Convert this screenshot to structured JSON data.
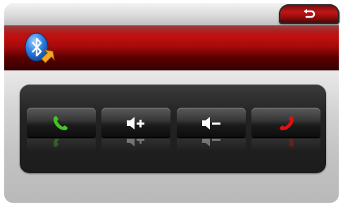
{
  "colors": {
    "accent_red": "#c21010",
    "call_green": "#3cc81e",
    "hangup_red": "#e01010",
    "button_dark": "#1a1a1a"
  },
  "icons": {
    "back": "return-arrow-icon",
    "bluetooth": "bluetooth-icon",
    "answer": "phone-answer-icon",
    "volume_up": "volume-up-icon",
    "volume_down": "volume-down-icon",
    "hangup": "phone-hangup-icon"
  },
  "controls": [
    {
      "id": "answer",
      "icon": "phone-answer-icon"
    },
    {
      "id": "volume_up",
      "icon": "volume-up-icon"
    },
    {
      "id": "volume_down",
      "icon": "volume-down-icon"
    },
    {
      "id": "hangup",
      "icon": "phone-hangup-icon"
    }
  ]
}
